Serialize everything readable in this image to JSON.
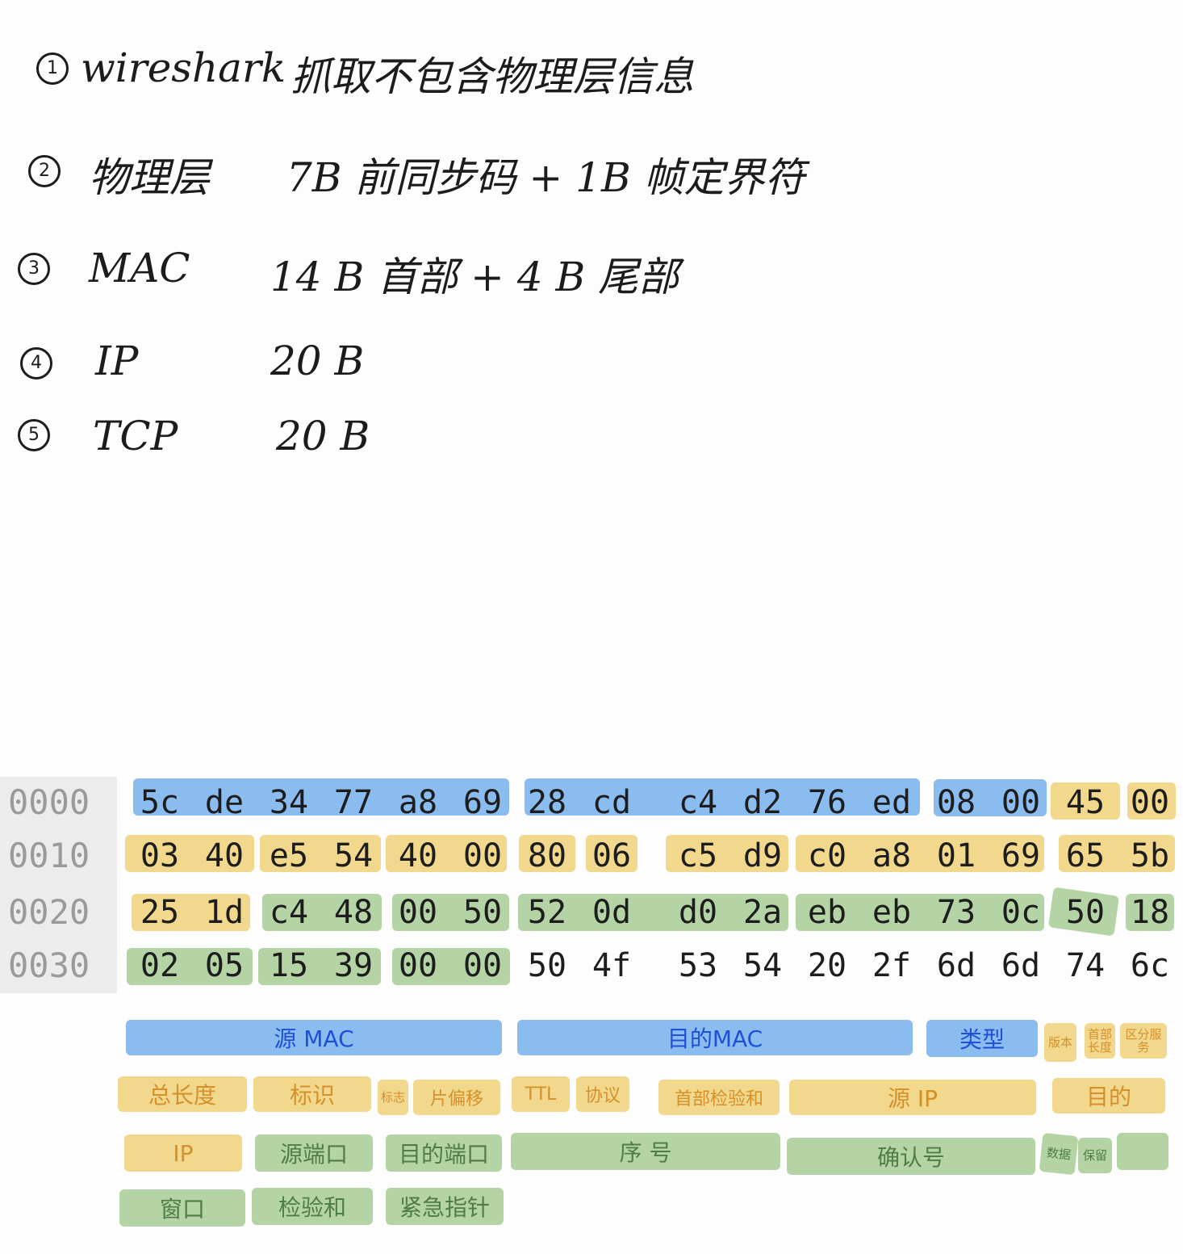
{
  "notes": [
    {
      "num": "1",
      "label": "wireshark",
      "detail": "抓取不包含物理层信息"
    },
    {
      "num": "2",
      "label": "物理层",
      "detail": "7B 前同步码 + 1B 帧定界符"
    },
    {
      "num": "3",
      "label": "MAC",
      "detail": "14 B 首部 + 4 B 尾部"
    },
    {
      "num": "4",
      "label": "IP",
      "detail": "20 B"
    },
    {
      "num": "5",
      "label": "TCP",
      "detail": "20 B"
    }
  ],
  "hex_dump": {
    "offsets": [
      "0000",
      "0010",
      "0020",
      "0030"
    ],
    "rows": [
      [
        "5c",
        "de",
        "34",
        "77",
        "a8",
        "69",
        "28",
        "cd",
        "c4",
        "d2",
        "76",
        "ed",
        "08",
        "00",
        "45",
        "00"
      ],
      [
        "03",
        "40",
        "e5",
        "54",
        "40",
        "00",
        "80",
        "06",
        "c5",
        "d9",
        "c0",
        "a8",
        "01",
        "69",
        "65",
        "5b"
      ],
      [
        "25",
        "1d",
        "c4",
        "48",
        "00",
        "50",
        "52",
        "0d",
        "d0",
        "2a",
        "eb",
        "eb",
        "73",
        "0c",
        "50",
        "18"
      ],
      [
        "02",
        "05",
        "15",
        "39",
        "00",
        "00",
        "50",
        "4f",
        "53",
        "54",
        "20",
        "2f",
        "6d",
        "6d",
        "74",
        "6c"
      ]
    ]
  },
  "colors": {
    "mac": "#8bbcf0",
    "ip": "#f1d88c",
    "tcp": "#b5d4a5",
    "mac_text": "#1f4fd6",
    "ip_text": "#d5902a",
    "tcp_text": "#4f7d45",
    "gutter": "#ececec"
  },
  "legend": {
    "src_mac": "源 MAC",
    "dst_mac": "目的MAC",
    "type": "类型",
    "version": "版本",
    "header_len": "首部长度",
    "diff_service": "区分服务",
    "total_len": "总长度",
    "identification": "标识",
    "flags": "标志",
    "frag_offset": "片偏移",
    "ttl": "TTL",
    "protocol": "协议",
    "header_checksum": "首部检验和",
    "src_ip": "源 IP",
    "dst_ip_1": "目的",
    "dst_ip_2": "IP",
    "src_port": "源端口",
    "dst_port": "目的端口",
    "seq": "序 号",
    "ack": "确认号",
    "data_offset": "数据",
    "reserved": "保留",
    "window": "窗口",
    "checksum": "检验和",
    "urgent_ptr": "紧急指针"
  }
}
